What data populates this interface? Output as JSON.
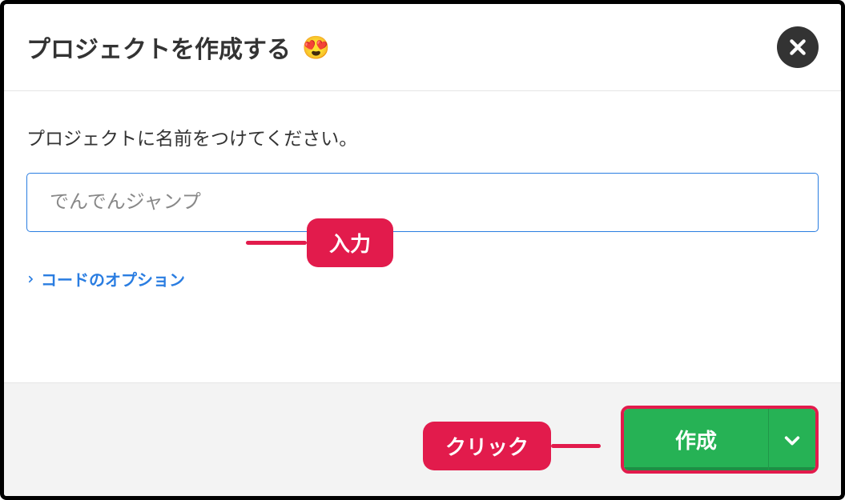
{
  "header": {
    "title": "プロジェクトを作成する",
    "emoji": "😍"
  },
  "body": {
    "label": "プロジェクトに名前をつけてください。",
    "input_placeholder": "でんでんジャンプ",
    "options_link": "コードのオプション"
  },
  "footer": {
    "create_label": "作成"
  },
  "annotations": {
    "input_label": "入力",
    "click_label": "クリック"
  }
}
